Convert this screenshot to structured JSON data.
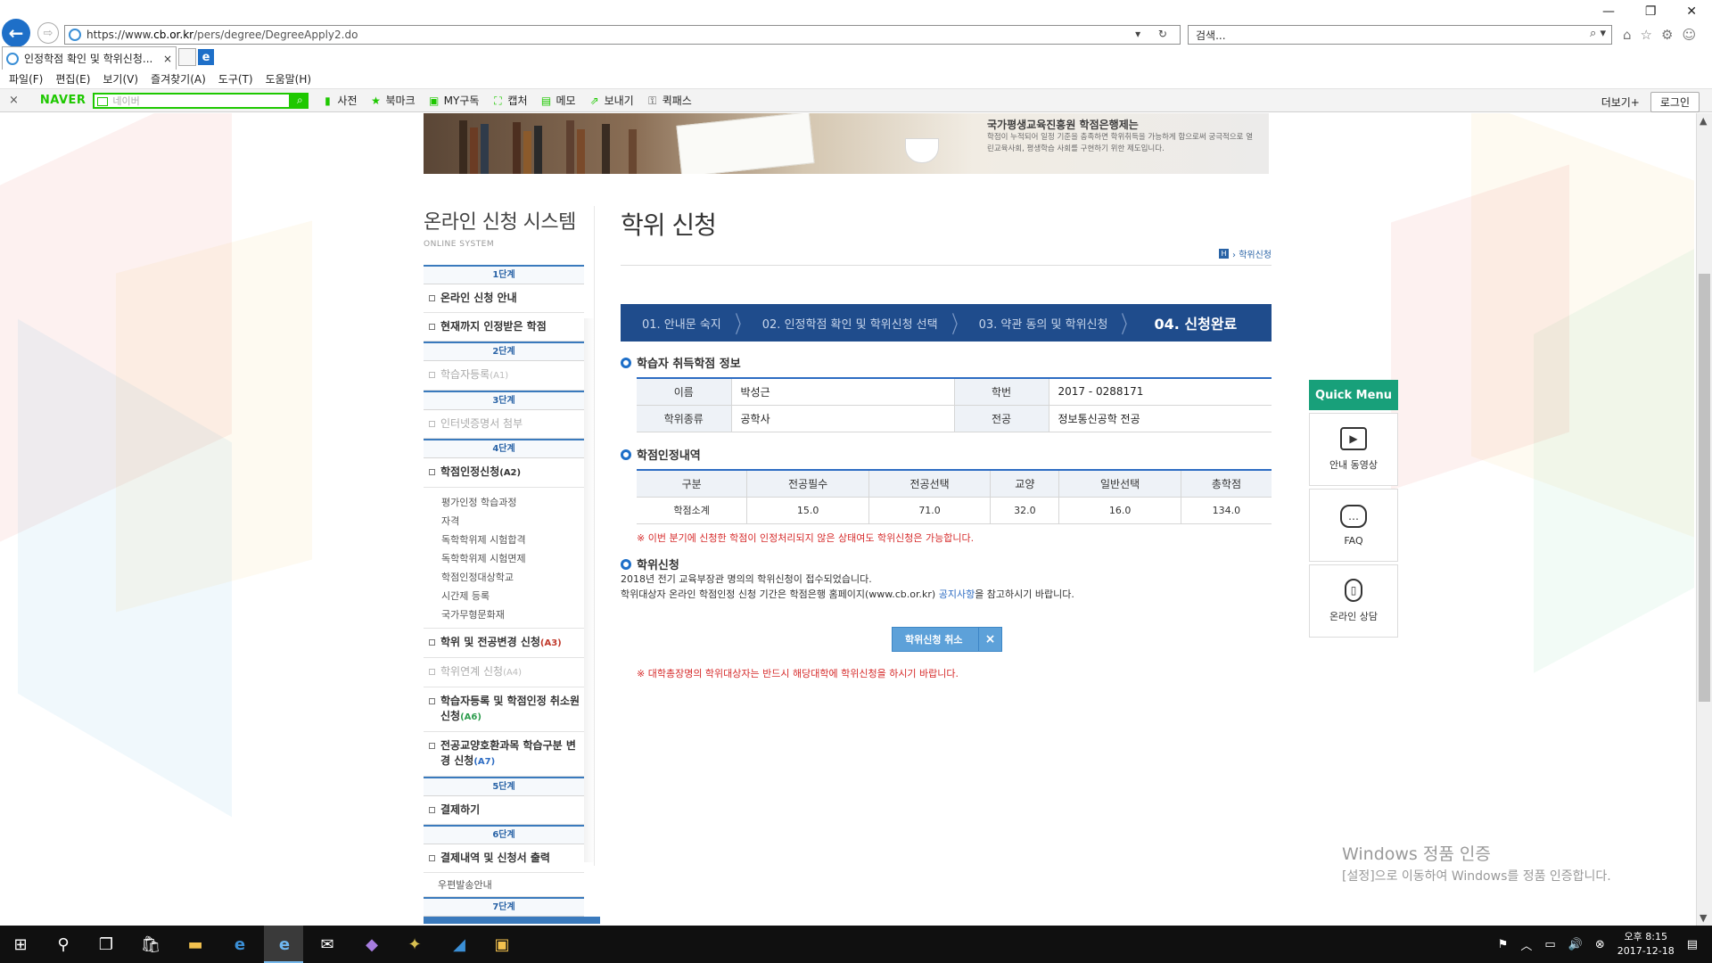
{
  "browser": {
    "url_prefix": "https://www.",
    "url_host": "cb.or.kr",
    "url_path": "/pers/degree/DegreeApply2.do",
    "address_tools": "▾ ↻",
    "search_placeholder": "검색...",
    "search_tools": "⌕ ▾",
    "tab_title": "인정학점 확인 및 학위신청...",
    "tab_close": "×",
    "back_glyph": "←",
    "forward_glyph": "⇨",
    "window_controls": [
      "—",
      "❐",
      "✕"
    ],
    "toolbar_icons": [
      "⌂",
      "☆",
      "⚙",
      "☺"
    ],
    "menu": [
      "파일(F)",
      "편집(E)",
      "보기(V)",
      "즐겨찾기(A)",
      "도구(T)",
      "도움말(H)"
    ]
  },
  "naver_bar": {
    "close": "×",
    "logo": "NAVER",
    "placeholder": "네이버",
    "search_glyph": "⌕",
    "items": [
      {
        "icon": "book-icon",
        "glyph": "▮",
        "label": "사전"
      },
      {
        "icon": "star-icon",
        "glyph": "★",
        "label": "북마크"
      },
      {
        "icon": "my-icon",
        "glyph": "▣",
        "label": "MY구독"
      },
      {
        "icon": "capture-icon",
        "glyph": "⛶",
        "label": "캡처"
      },
      {
        "icon": "memo-icon",
        "glyph": "▤",
        "label": "메모"
      },
      {
        "icon": "share-icon",
        "glyph": "⇗",
        "label": "보내기"
      },
      {
        "icon": "key-icon",
        "glyph": "⚿",
        "label": "퀵패스"
      }
    ],
    "more": "더보기+",
    "login": "로그인"
  },
  "banner": {
    "title": "국가평생교육진흥원 학점은행제는",
    "desc": "학점이 누적되어 일정 기준을 충족하면 학위취득을 가능하게 함으로써 궁극적으로 열린교육사회, 평생학습 사회를 구현하기 위한 제도입니다."
  },
  "left_nav": {
    "title": "온라인 신청 시스템",
    "subtitle": "ONLINE SYSTEM",
    "stage1": "1단계",
    "item_guide": "온라인 신청 안내",
    "item_current_credits": "현재까지 인정받은 학점",
    "stage2": "2단계",
    "item_register": "학습자등록",
    "item_register_code": "(A1)",
    "stage3": "3단계",
    "item_certificate": "인터넷증명서 첨부",
    "stage4": "4단계",
    "item_credit_apply": "학점인정신청",
    "item_credit_apply_code": "(A2)",
    "sub_items": [
      "평가인정 학습과정",
      "자격",
      "독학학위제 시험합격",
      "독학학위제 시험면제",
      "학점인정대상학교",
      "시간제 등록",
      "국가무형문화재"
    ],
    "item_degree_major": "학위 및 전공변경 신청",
    "item_degree_major_code": "(A3)",
    "item_degree_link": "학위연계 신청",
    "item_degree_link_code": "(A4)",
    "item_cancel": "학습자등록 및 학점인정 취소원 신청",
    "item_cancel_code": "(A6)",
    "item_subject_change": "전공교양호환과목 학습구분 변경 신청",
    "item_subject_change_code": "(A7)",
    "stage5": "5단계",
    "item_pay": "결제하기",
    "stage6": "6단계",
    "item_pay_history": "결제내역 및 신청서 출력",
    "item_mail": "우편발송안내",
    "stage7": "7단계"
  },
  "content": {
    "title": "학위 신청",
    "home_glyph": "H",
    "breadcrumb": "› 학위신청",
    "steps": [
      "01. 안내문 숙지",
      "02. 인정학점 확인 및 학위신청 선택",
      "03. 약관 동의 및 학위신청",
      "04. 신청완료"
    ],
    "step_separator": "〉",
    "info_heading": "학습자 취득학점 정보",
    "info": {
      "name_label": "이름",
      "name": "박성근",
      "id_label": "학번",
      "id": "2017 - 0288171",
      "degree_label": "학위종류",
      "degree": "공학사",
      "major_label": "전공",
      "major": "정보통신공학 전공"
    },
    "credit_heading": "학점인정내역",
    "credit_headers": [
      "구분",
      "전공필수",
      "전공선택",
      "교양",
      "일반선택",
      "총학점"
    ],
    "credit_row": [
      "학점소계",
      "15.0",
      "71.0",
      "32.0",
      "16.0",
      "134.0"
    ],
    "credit_note": "※ 이번 분기에 신청한 학점이 인정처리되지 않은 상태여도 학위신청은 가능합니다.",
    "apply_heading": "학위신청",
    "apply_line1": "2018년 전기 교육부장관 명의의 학위신청이 접수되었습니다.",
    "apply_line2_pre": "학위대상자 온라인 학점인정 신청 기간은 학점은행 홈페이지(www.cb.or.kr) ",
    "apply_link": "공지사항",
    "apply_line2_post": "을 참고하시기 바랍니다.",
    "cancel_button": "학위신청 취소",
    "cancel_x": "×",
    "bottom_note": "※ 대학총장명의 학위대상자는 반드시 해당대학에 학위신청을 하시기 바랍니다."
  },
  "quick_menu": {
    "title": "Quick Menu",
    "items": [
      {
        "label": "안내 동영상",
        "glyph": "▶"
      },
      {
        "label": "FAQ",
        "glyph": "…"
      },
      {
        "label": "온라인 상담",
        "glyph": "▯"
      }
    ]
  },
  "watermark": {
    "title": "Windows 정품 인증",
    "desc": "[설정]으로 이동하여 Windows를 정품 인증합니다."
  },
  "taskbar": {
    "icons": [
      {
        "name": "start-icon",
        "glyph": "⊞"
      },
      {
        "name": "search-icon",
        "glyph": "⚲"
      },
      {
        "name": "task-view-icon",
        "glyph": "❐"
      },
      {
        "name": "store-icon",
        "glyph": "🛍"
      },
      {
        "name": "explorer-icon",
        "glyph": "▬"
      },
      {
        "name": "edge-icon",
        "glyph": "e"
      },
      {
        "name": "ie-icon",
        "glyph": "e"
      },
      {
        "name": "mail-icon",
        "glyph": "✉"
      },
      {
        "name": "visual-studio-icon",
        "glyph": "◆"
      },
      {
        "name": "app-icon",
        "glyph": "✦"
      },
      {
        "name": "paint-icon",
        "glyph": "◢"
      },
      {
        "name": "note-icon",
        "glyph": "▣"
      }
    ],
    "tray_glyphs": [
      "⚑",
      "︿",
      "▭",
      "🔊",
      "⊗"
    ],
    "time": "오후 8:15",
    "date": "2017-12-18",
    "notification_glyph": "▤"
  }
}
